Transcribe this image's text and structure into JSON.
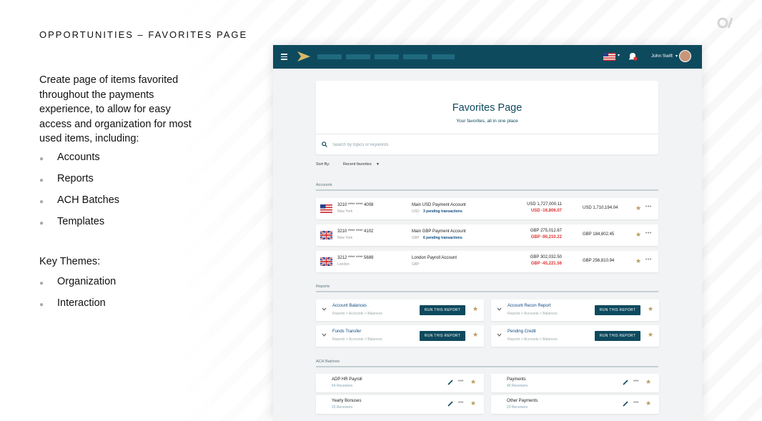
{
  "slide": {
    "title": "OPPORTUNITIES – FAVORITES PAGE",
    "intro": "Create page of items favorited throughout the payments experience, to allow for easy access and organization for most used items, including:",
    "items": [
      "Accounts",
      "Reports",
      "ACH Batches",
      "Templates"
    ],
    "key_themes_title": "Key Themes:",
    "key_themes": [
      "Organization",
      "Interaction"
    ],
    "logo_icon": "brand-logo-icon"
  },
  "app": {
    "header": {
      "user_name": "John Swift",
      "menu_icon": "hamburger-icon",
      "brand_icon": "brand-arrow-icon",
      "notification_icon": "bell-icon",
      "colors": {
        "bar": "#0e4a5e",
        "accent": "#b89b5e",
        "negative": "#dd3333"
      }
    },
    "hero": {
      "title": "Favorites Page",
      "subtitle": "Your favorites, all in one place",
      "search_placeholder": "Search by topics or keywords"
    },
    "sort": {
      "label": "Sort By:",
      "value": "Recent favorites"
    },
    "accounts": {
      "label": "Accounts",
      "rows": [
        {
          "flag": "us-flag-icon",
          "number": "3210 **** **** 4008",
          "location": "New York",
          "name": "Main USD Payment Account",
          "currency": "USD",
          "pending": "3 pending transactions",
          "balance": "USD 1,727,000.11",
          "negative": "USD -16,806.07",
          "total": "USD 1,710,194.04"
        },
        {
          "flag": "uk-flag-icon",
          "number": "3210 **** **** 4102",
          "location": "New York",
          "name": "Main GBP Payment Account",
          "currency": "GBP",
          "pending": "6 pending transactions",
          "balance": "GBP 275,012.67",
          "negative": "GBP -90,210.22",
          "total": "GBP 184,802.45"
        },
        {
          "flag": "uk-flag-icon",
          "number": "3212 **** **** 5689",
          "location": "London",
          "name": "London Payroll Account",
          "currency": "GBP",
          "pending": "",
          "balance": "GBP 302,032.50",
          "negative": "GBP -45,221.56",
          "total": "GBP 256,810.94"
        }
      ]
    },
    "reports": {
      "label": "Reports",
      "button_label": "RUN THIS REPORT",
      "items": [
        {
          "title": "Account Balances",
          "path": "Reports  >  Accounts  >  Balances"
        },
        {
          "title": "Account Recon Report",
          "path": "Reports  >  Accounts  >  Balances"
        },
        {
          "title": "Funds Transfer",
          "path": "Reports  >  Accounts  >  Balances"
        },
        {
          "title": "Pending Credit",
          "path": "Reports  >  Accounts  >  Balances"
        }
      ]
    },
    "ach": {
      "label": "ACH Batches",
      "items": [
        {
          "title": "ADP HR Payroll",
          "sub": "64 Receivers"
        },
        {
          "title": "Payments",
          "sub": "40 Receivers"
        },
        {
          "title": "Yearly Bonuses",
          "sub": "23 Receivers"
        },
        {
          "title": "Other Payments",
          "sub": "23 Receivers"
        }
      ]
    },
    "more_label": "•••",
    "star_glyph": "★"
  }
}
